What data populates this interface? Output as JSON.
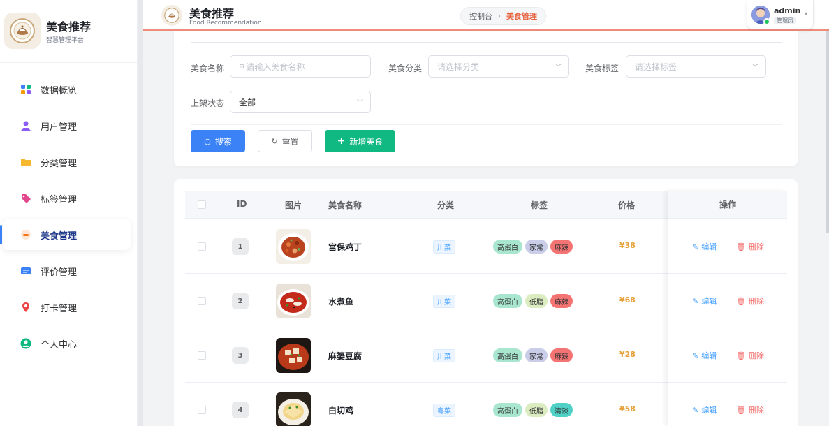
{
  "brand": {
    "title": "美食推荐",
    "subtitle": "智慧管理平台"
  },
  "menu": [
    {
      "label": "数据概览",
      "icon": "grid-icon",
      "color": "#3b82f6"
    },
    {
      "label": "用户管理",
      "icon": "users-icon",
      "color": "#8b5cf6"
    },
    {
      "label": "分类管理",
      "icon": "folder-icon",
      "color": "#f5b82e"
    },
    {
      "label": "标签管理",
      "icon": "tag-icon",
      "color": "#e2468b"
    },
    {
      "label": "美食管理",
      "icon": "food-icon",
      "color": "#f97316",
      "active": true
    },
    {
      "label": "评价管理",
      "icon": "comment-icon",
      "color": "#3b82f6"
    },
    {
      "label": "打卡管理",
      "icon": "location-pin-icon",
      "color": "#ef4444"
    },
    {
      "label": "个人中心",
      "icon": "user-circle-icon",
      "color": "#10b981"
    }
  ],
  "header": {
    "title": "美食推荐",
    "subtitle": "Food Recommendation",
    "breadcrumb": [
      "控制台",
      "美食管理"
    ],
    "user": {
      "name": "admin",
      "role": "管理员"
    }
  },
  "search": {
    "name_label": "美食名称",
    "name_placeholder": "请输入美食名称",
    "category_label": "美食分类",
    "category_placeholder": "请选择分类",
    "tag_label": "美食标签",
    "tag_placeholder": "请选择标签",
    "status_label": "上架状态",
    "status_value": "全部",
    "search_btn": "搜索",
    "reset_btn": "重置",
    "add_btn": "新增美食"
  },
  "table": {
    "columns": [
      "ID",
      "图片",
      "美食名称",
      "分类",
      "标签",
      "价格",
      "操作"
    ],
    "edit_label": "编辑",
    "delete_label": "删除",
    "rows": [
      {
        "id": "1",
        "name": "宫保鸡丁",
        "category": "川菜",
        "tags": [
          "高蛋白",
          "家常",
          "麻辣"
        ],
        "price": "¥38"
      },
      {
        "id": "2",
        "name": "水煮鱼",
        "category": "川菜",
        "tags": [
          "高蛋白",
          "低脂",
          "麻辣"
        ],
        "price": "¥68"
      },
      {
        "id": "3",
        "name": "麻婆豆腐",
        "category": "川菜",
        "tags": [
          "高蛋白",
          "家常",
          "麻辣"
        ],
        "price": "¥28"
      },
      {
        "id": "4",
        "name": "白切鸡",
        "category": "粤菜",
        "tags": [
          "高蛋白",
          "低脂",
          "清淡"
        ],
        "price": "¥58"
      }
    ]
  },
  "tag_colors": {
    "高蛋白": "#a8e6cf",
    "家常": "#c9cde8",
    "麻辣": "#f47373",
    "低脂": "#dbecc0",
    "清淡": "#4fd1c5"
  }
}
